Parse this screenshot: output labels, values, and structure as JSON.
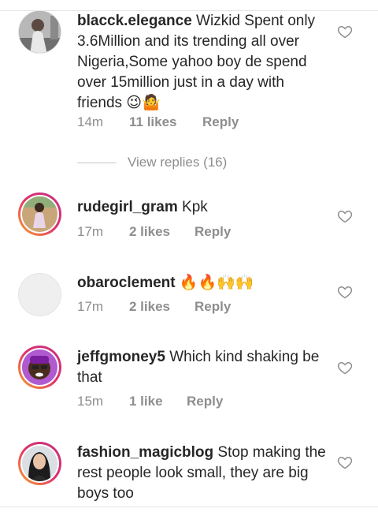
{
  "comments": [
    {
      "username": "blacck.elegance",
      "text": "Wizkid Spent only 3.6Million  and its trending all over Nigeria,Some yahoo boy de spend over 15million just in a day with friends 😉🤷",
      "time": "14m",
      "likes": "11 likes",
      "reply": "Reply"
    },
    {
      "username": "rudegirl_gram",
      "text": "Kpk",
      "time": "17m",
      "likes": "2 likes",
      "reply": "Reply"
    },
    {
      "username": "obaroclement",
      "text": "🔥🔥🙌🙌",
      "time": "17m",
      "likes": "2 likes",
      "reply": "Reply"
    },
    {
      "username": "jeffgmoney5",
      "text": "Which kind shaking be that",
      "time": "15m",
      "likes": "1 like",
      "reply": "Reply"
    },
    {
      "username": "fashion_magicblog",
      "text": "Stop making the rest people look small, they are big boys too",
      "time": "",
      "likes": "",
      "reply": ""
    }
  ],
  "view_replies": "View replies (16)",
  "icons": {
    "like": "heart-outline-icon"
  },
  "colors": {
    "text": "#262626",
    "muted": "#8e8e8e",
    "story_ring": "#e1306c"
  }
}
